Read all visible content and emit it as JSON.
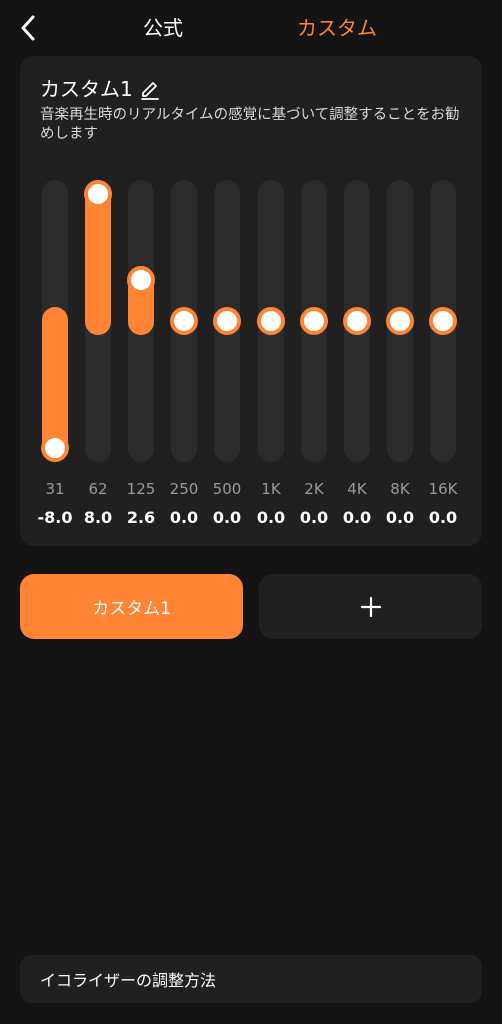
{
  "header": {
    "tabs": [
      {
        "label": "公式",
        "active": false
      },
      {
        "label": "カスタム",
        "active": true
      }
    ]
  },
  "eq_card": {
    "title": "カスタム1",
    "description": "音楽再生時のリアルタイムの感覚に基づいて調整することをお勧めします",
    "range_db": [
      -8,
      8
    ],
    "bands": [
      {
        "freq": "31",
        "gain": "-8.0"
      },
      {
        "freq": "62",
        "gain": "8.0"
      },
      {
        "freq": "125",
        "gain": "2.6"
      },
      {
        "freq": "250",
        "gain": "0.0"
      },
      {
        "freq": "500",
        "gain": "0.0"
      },
      {
        "freq": "1K",
        "gain": "0.0"
      },
      {
        "freq": "2K",
        "gain": "0.0"
      },
      {
        "freq": "4K",
        "gain": "0.0"
      },
      {
        "freq": "8K",
        "gain": "0.0"
      },
      {
        "freq": "16K",
        "gain": "0.0"
      }
    ]
  },
  "presets": {
    "current_label": "カスタム1",
    "add_icon": "plus-icon"
  },
  "footer": {
    "help_label": "イコライザーの調整方法"
  },
  "colors": {
    "accent": "#ff8433",
    "background": "#141414",
    "card": "#202020"
  }
}
